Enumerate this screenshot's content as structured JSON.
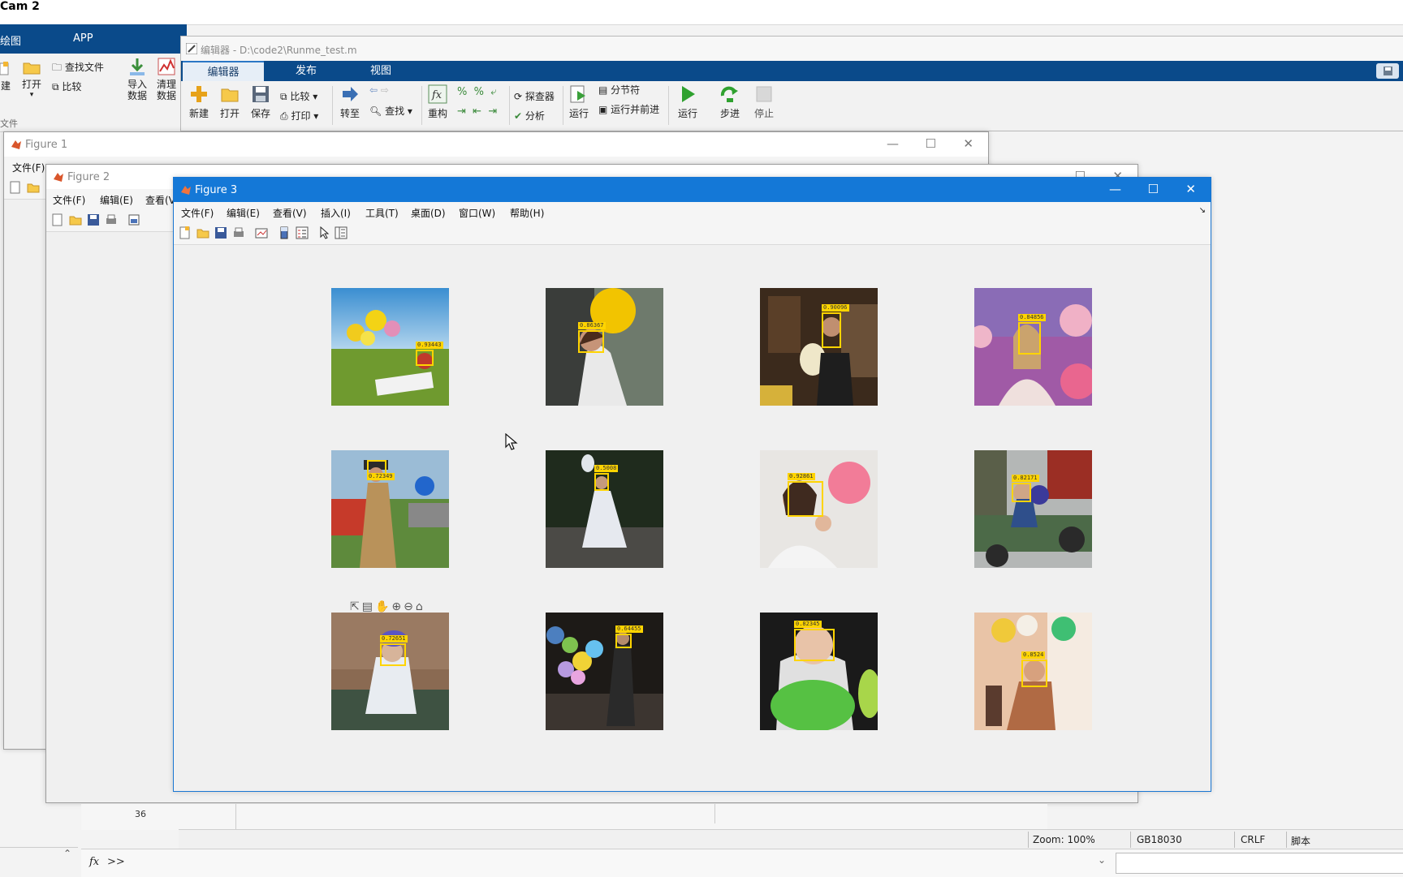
{
  "app": {
    "title": "Cam 2",
    "tabs": [
      "绘图",
      "APP"
    ],
    "toolstrip": {
      "new": "建",
      "open": "打开",
      "find_files": "查找文件",
      "compare": "比较",
      "import": "导入\n数据",
      "clean": "清理\n数据",
      "section": "文件"
    }
  },
  "editor": {
    "title": "编辑器 - D:\\code2\\Runme_test.m",
    "tabs": [
      "编辑器",
      "发布",
      "视图"
    ],
    "buttons": {
      "new": "新建",
      "open": "打开",
      "save": "保存",
      "compare": "比较",
      "print": "打印",
      "goto": "转至",
      "find": "查找",
      "refactor": "重构",
      "profiler": "探查器",
      "analyze": "分析",
      "run_section_btn": "运行",
      "section_break": "分节符",
      "run_and_advance": "运行并前进",
      "run": "运行",
      "step": "步进",
      "stop": "停止"
    }
  },
  "figure1": {
    "title": "Figure 1",
    "menu_first": "文件(F)"
  },
  "figure2": {
    "title": "Figure 2",
    "menus": [
      "文件(F)",
      "编辑(E)",
      "查看(V"
    ]
  },
  "figure3": {
    "title": "Figure 3",
    "menus": [
      "文件(F)",
      "编辑(E)",
      "查看(V)",
      "插入(I)",
      "工具(T)",
      "桌面(D)",
      "窗口(W)",
      "帮助(H)"
    ],
    "photos": [
      {
        "scene": "balloons-meadow-child",
        "score": "0.93443"
      },
      {
        "scene": "girl-yellow-balloon",
        "score": "0.86367"
      },
      {
        "scene": "party-man-balloon",
        "score": "0.90096"
      },
      {
        "scene": "woman-pink-balloons",
        "score": "0.84856"
      },
      {
        "scene": "stilt-walker-car",
        "score": "0.72349"
      },
      {
        "scene": "girl-white-dress-rocks",
        "score": "0.5008"
      },
      {
        "scene": "girl-pink-balloon",
        "score": "0.92861"
      },
      {
        "scene": "child-railway-cart",
        "score": "0.82171"
      },
      {
        "scene": "child-railway-helmet",
        "score": "0.72651"
      },
      {
        "scene": "night-balloons",
        "score": "0.64455"
      },
      {
        "scene": "baby-green-balloon",
        "score": "0.82345"
      },
      {
        "scene": "woman-wall-balloons",
        "score": "0.8524"
      }
    ]
  },
  "status": {
    "line": "36",
    "zoom": "Zoom: 100%",
    "encoding": "GB18030",
    "eol": "CRLF",
    "type": "脚本"
  },
  "command": {
    "prompt": ">>",
    "fx": "fx"
  },
  "colors": {
    "accent": "#1478d7",
    "bbox": "#ffd400",
    "tabbar": "#0a4a8a"
  }
}
